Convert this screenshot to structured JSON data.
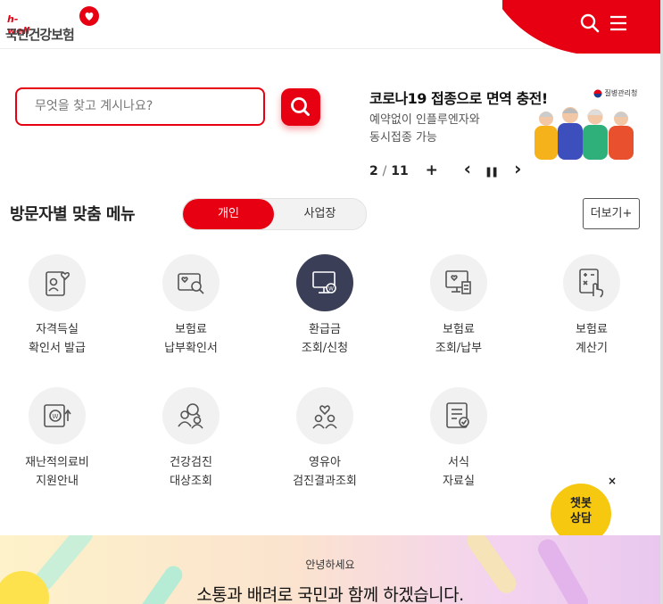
{
  "header": {
    "logo_sub": "h-well",
    "logo_main": "국민건강보험",
    "search_icon": "search-icon",
    "menu_icon": "hamburger-menu-icon"
  },
  "search": {
    "placeholder": "무엇을 찾고 계시나요?",
    "button_icon": "search-icon"
  },
  "banner": {
    "title": "코로나19 접종으로 면역 충전!",
    "desc_line1": "예약없이 인플루엔자와",
    "desc_line2": "동시접종 가능",
    "agency": "질병관리청",
    "page_current": "2",
    "page_total": "11",
    "pager_sep": "/",
    "plus": "+",
    "prev": "‹",
    "pause": "❚❚",
    "next": "›"
  },
  "visitor_menu": {
    "title": "방문자별 맞춤 메뉴",
    "tabs": [
      {
        "label": "개인",
        "active": true
      },
      {
        "label": "사업장",
        "active": false
      }
    ],
    "more_label": "더보기+",
    "items": [
      {
        "line1": "자격득실",
        "line2": "확인서 발급",
        "icon": "id-card-heart-icon"
      },
      {
        "line1": "보험료",
        "line2": "납부확인서",
        "icon": "document-search-icon"
      },
      {
        "line1": "환급금",
        "line2": "조회/신청",
        "icon": "monitor-won-icon"
      },
      {
        "line1": "보험료",
        "line2": "조회/납부",
        "icon": "computer-receipt-icon"
      },
      {
        "line1": "보험료",
        "line2": "계산기",
        "icon": "calculator-hand-icon"
      },
      {
        "line1": "재난적의료비",
        "line2": "지원안내",
        "icon": "won-support-icon"
      },
      {
        "line1": "건강검진",
        "line2": "대상조회",
        "icon": "people-search-icon"
      },
      {
        "line1": "영유아",
        "line2": "검진결과조회",
        "icon": "child-heart-icon"
      },
      {
        "line1": "서식",
        "line2": "자료실",
        "icon": "form-document-icon"
      }
    ]
  },
  "chatbot": {
    "label_line1": "챗봇",
    "label_line2": "상담",
    "close": "×"
  },
  "bottom_banner": {
    "greeting": "안녕하세요",
    "message": "소통과 배려로 국민과 함께 하겠습니다."
  },
  "colors": {
    "brand_red": "#e60012",
    "active_dark": "#3a3f57",
    "chatbot_yellow": "#f6c80f"
  }
}
